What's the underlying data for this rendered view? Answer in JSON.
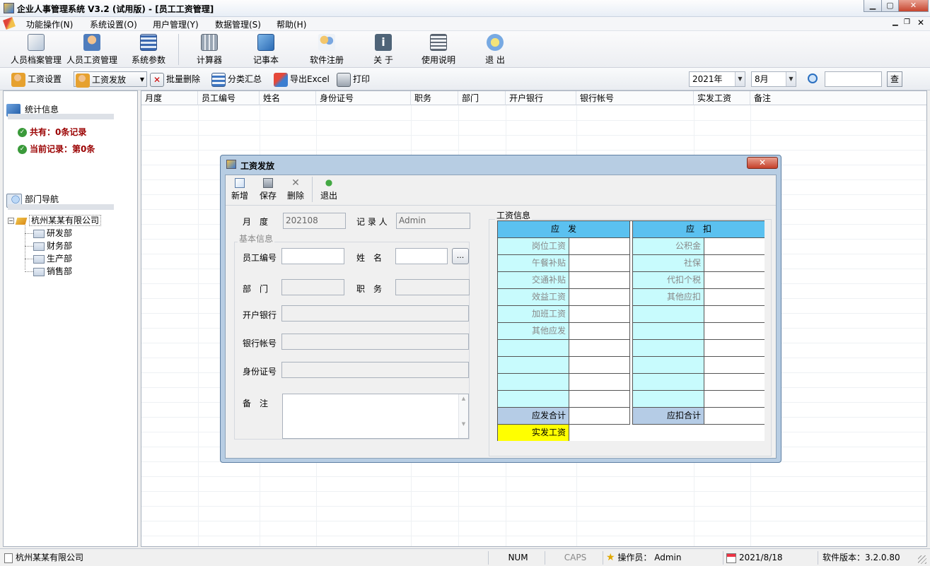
{
  "window": {
    "title": "企业人事管理系统 V3.2 (试用版) - [员工工资管理]"
  },
  "menu": [
    "功能操作(N)",
    "系统设置(O)",
    "用户管理(Y)",
    "数据管理(S)",
    "帮助(H)"
  ],
  "toolbar": [
    {
      "label": "人员档案管理",
      "icon": "edit-icon"
    },
    {
      "label": "人员工资管理",
      "icon": "person-icon"
    },
    {
      "label": "系统参数",
      "icon": "grid-icon"
    },
    {
      "label": "计算器",
      "icon": "calculator-icon"
    },
    {
      "label": "记事本",
      "icon": "notebook-icon"
    },
    {
      "label": "软件注册",
      "icon": "users-icon"
    },
    {
      "label": "关 于",
      "icon": "info-icon"
    },
    {
      "label": "使用说明",
      "icon": "document-icon"
    },
    {
      "label": "退 出",
      "icon": "exit-icon"
    }
  ],
  "subtoolbar": {
    "salary_settings": "工资设置",
    "salary_pay": "工资发放",
    "batch_delete": "批量删除",
    "category_summary": "分类汇总",
    "export_excel": "导出Excel",
    "print": "打印",
    "year": "2021年",
    "month": "8月",
    "search_button": "查"
  },
  "left": {
    "stats_title": "统计信息",
    "total": "共有：0条记录",
    "current": "当前记录：第0条",
    "dept_title": "部门导航",
    "company": "杭州某某有限公司",
    "departments": [
      "研发部",
      "财务部",
      "生产部",
      "销售部"
    ]
  },
  "grid": {
    "columns": [
      "月度",
      "员工编号",
      "姓名",
      "身份证号",
      "职务",
      "部门",
      "开户银行",
      "银行帐号",
      "实发工资",
      "备注"
    ]
  },
  "dialog": {
    "title": "工资发放",
    "buttons": [
      "新增",
      "保存",
      "删除",
      "退出"
    ],
    "month_label": "月　度",
    "month_value": "202108",
    "recorder_label": "记 录 人",
    "recorder_value": "Admin",
    "basic_info": "基本信息",
    "emp_no_label": "员工编号",
    "name_label": "姓　名",
    "browse_button": "...",
    "dept_label": "部　门",
    "position_label": "职　务",
    "bank_label": "开户银行",
    "account_label": "银行帐号",
    "id_label": "身份证号",
    "remark_label": "备　注",
    "salary_info": "工资信息",
    "payable_header": "应　发",
    "deduct_header": "应　扣",
    "payable_items": [
      "岗位工资",
      "午餐补贴",
      "交通补贴",
      "效益工资",
      "加班工资",
      "其他应发"
    ],
    "deduct_items": [
      "公积金",
      "社保",
      "代扣个税",
      "其他应扣"
    ],
    "payable_total": "应发合计",
    "deduct_total": "应扣合计",
    "net_pay": "实发工资"
  },
  "status": {
    "company": "杭州某某有限公司",
    "num": "NUM",
    "caps": "CAPS",
    "operator": "操作员：  Admin",
    "date": "2021/8/18",
    "version": "软件版本：3.2.0.80"
  },
  "colors": {
    "header_blue": "#5bc1f0",
    "cyan_cell": "#c8fbfd",
    "total_blue": "#b5cce6",
    "net_yellow": "#ffff00",
    "stat_red": "#9a0000"
  }
}
